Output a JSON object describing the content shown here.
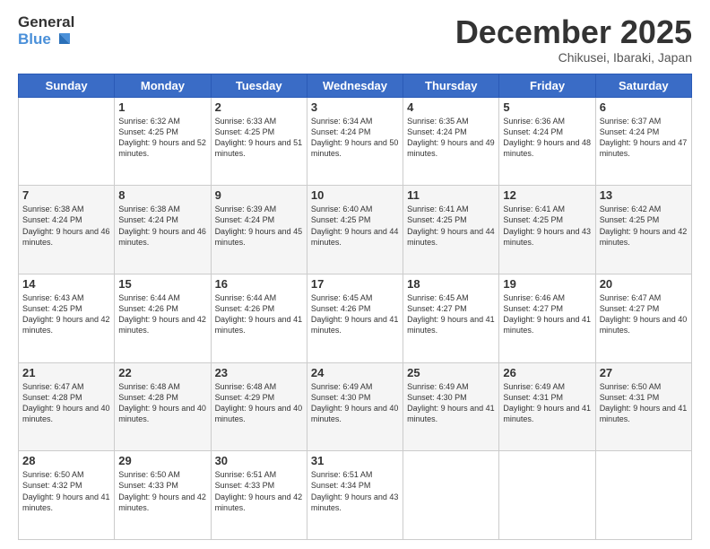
{
  "logo": {
    "general": "General",
    "blue": "Blue"
  },
  "title": "December 2025",
  "location": "Chikusei, Ibaraki, Japan",
  "weekdays": [
    "Sunday",
    "Monday",
    "Tuesday",
    "Wednesday",
    "Thursday",
    "Friday",
    "Saturday"
  ],
  "weeks": [
    [
      {
        "day": "",
        "sunrise": "",
        "sunset": "",
        "daylight": ""
      },
      {
        "day": "1",
        "sunrise": "Sunrise: 6:32 AM",
        "sunset": "Sunset: 4:25 PM",
        "daylight": "Daylight: 9 hours and 52 minutes."
      },
      {
        "day": "2",
        "sunrise": "Sunrise: 6:33 AM",
        "sunset": "Sunset: 4:25 PM",
        "daylight": "Daylight: 9 hours and 51 minutes."
      },
      {
        "day": "3",
        "sunrise": "Sunrise: 6:34 AM",
        "sunset": "Sunset: 4:24 PM",
        "daylight": "Daylight: 9 hours and 50 minutes."
      },
      {
        "day": "4",
        "sunrise": "Sunrise: 6:35 AM",
        "sunset": "Sunset: 4:24 PM",
        "daylight": "Daylight: 9 hours and 49 minutes."
      },
      {
        "day": "5",
        "sunrise": "Sunrise: 6:36 AM",
        "sunset": "Sunset: 4:24 PM",
        "daylight": "Daylight: 9 hours and 48 minutes."
      },
      {
        "day": "6",
        "sunrise": "Sunrise: 6:37 AM",
        "sunset": "Sunset: 4:24 PM",
        "daylight": "Daylight: 9 hours and 47 minutes."
      }
    ],
    [
      {
        "day": "7",
        "sunrise": "Sunrise: 6:38 AM",
        "sunset": "Sunset: 4:24 PM",
        "daylight": "Daylight: 9 hours and 46 minutes."
      },
      {
        "day": "8",
        "sunrise": "Sunrise: 6:38 AM",
        "sunset": "Sunset: 4:24 PM",
        "daylight": "Daylight: 9 hours and 46 minutes."
      },
      {
        "day": "9",
        "sunrise": "Sunrise: 6:39 AM",
        "sunset": "Sunset: 4:24 PM",
        "daylight": "Daylight: 9 hours and 45 minutes."
      },
      {
        "day": "10",
        "sunrise": "Sunrise: 6:40 AM",
        "sunset": "Sunset: 4:25 PM",
        "daylight": "Daylight: 9 hours and 44 minutes."
      },
      {
        "day": "11",
        "sunrise": "Sunrise: 6:41 AM",
        "sunset": "Sunset: 4:25 PM",
        "daylight": "Daylight: 9 hours and 44 minutes."
      },
      {
        "day": "12",
        "sunrise": "Sunrise: 6:41 AM",
        "sunset": "Sunset: 4:25 PM",
        "daylight": "Daylight: 9 hours and 43 minutes."
      },
      {
        "day": "13",
        "sunrise": "Sunrise: 6:42 AM",
        "sunset": "Sunset: 4:25 PM",
        "daylight": "Daylight: 9 hours and 42 minutes."
      }
    ],
    [
      {
        "day": "14",
        "sunrise": "Sunrise: 6:43 AM",
        "sunset": "Sunset: 4:25 PM",
        "daylight": "Daylight: 9 hours and 42 minutes."
      },
      {
        "day": "15",
        "sunrise": "Sunrise: 6:44 AM",
        "sunset": "Sunset: 4:26 PM",
        "daylight": "Daylight: 9 hours and 42 minutes."
      },
      {
        "day": "16",
        "sunrise": "Sunrise: 6:44 AM",
        "sunset": "Sunset: 4:26 PM",
        "daylight": "Daylight: 9 hours and 41 minutes."
      },
      {
        "day": "17",
        "sunrise": "Sunrise: 6:45 AM",
        "sunset": "Sunset: 4:26 PM",
        "daylight": "Daylight: 9 hours and 41 minutes."
      },
      {
        "day": "18",
        "sunrise": "Sunrise: 6:45 AM",
        "sunset": "Sunset: 4:27 PM",
        "daylight": "Daylight: 9 hours and 41 minutes."
      },
      {
        "day": "19",
        "sunrise": "Sunrise: 6:46 AM",
        "sunset": "Sunset: 4:27 PM",
        "daylight": "Daylight: 9 hours and 41 minutes."
      },
      {
        "day": "20",
        "sunrise": "Sunrise: 6:47 AM",
        "sunset": "Sunset: 4:27 PM",
        "daylight": "Daylight: 9 hours and 40 minutes."
      }
    ],
    [
      {
        "day": "21",
        "sunrise": "Sunrise: 6:47 AM",
        "sunset": "Sunset: 4:28 PM",
        "daylight": "Daylight: 9 hours and 40 minutes."
      },
      {
        "day": "22",
        "sunrise": "Sunrise: 6:48 AM",
        "sunset": "Sunset: 4:28 PM",
        "daylight": "Daylight: 9 hours and 40 minutes."
      },
      {
        "day": "23",
        "sunrise": "Sunrise: 6:48 AM",
        "sunset": "Sunset: 4:29 PM",
        "daylight": "Daylight: 9 hours and 40 minutes."
      },
      {
        "day": "24",
        "sunrise": "Sunrise: 6:49 AM",
        "sunset": "Sunset: 4:30 PM",
        "daylight": "Daylight: 9 hours and 40 minutes."
      },
      {
        "day": "25",
        "sunrise": "Sunrise: 6:49 AM",
        "sunset": "Sunset: 4:30 PM",
        "daylight": "Daylight: 9 hours and 41 minutes."
      },
      {
        "day": "26",
        "sunrise": "Sunrise: 6:49 AM",
        "sunset": "Sunset: 4:31 PM",
        "daylight": "Daylight: 9 hours and 41 minutes."
      },
      {
        "day": "27",
        "sunrise": "Sunrise: 6:50 AM",
        "sunset": "Sunset: 4:31 PM",
        "daylight": "Daylight: 9 hours and 41 minutes."
      }
    ],
    [
      {
        "day": "28",
        "sunrise": "Sunrise: 6:50 AM",
        "sunset": "Sunset: 4:32 PM",
        "daylight": "Daylight: 9 hours and 41 minutes."
      },
      {
        "day": "29",
        "sunrise": "Sunrise: 6:50 AM",
        "sunset": "Sunset: 4:33 PM",
        "daylight": "Daylight: 9 hours and 42 minutes."
      },
      {
        "day": "30",
        "sunrise": "Sunrise: 6:51 AM",
        "sunset": "Sunset: 4:33 PM",
        "daylight": "Daylight: 9 hours and 42 minutes."
      },
      {
        "day": "31",
        "sunrise": "Sunrise: 6:51 AM",
        "sunset": "Sunset: 4:34 PM",
        "daylight": "Daylight: 9 hours and 43 minutes."
      },
      {
        "day": "",
        "sunrise": "",
        "sunset": "",
        "daylight": ""
      },
      {
        "day": "",
        "sunrise": "",
        "sunset": "",
        "daylight": ""
      },
      {
        "day": "",
        "sunrise": "",
        "sunset": "",
        "daylight": ""
      }
    ]
  ]
}
